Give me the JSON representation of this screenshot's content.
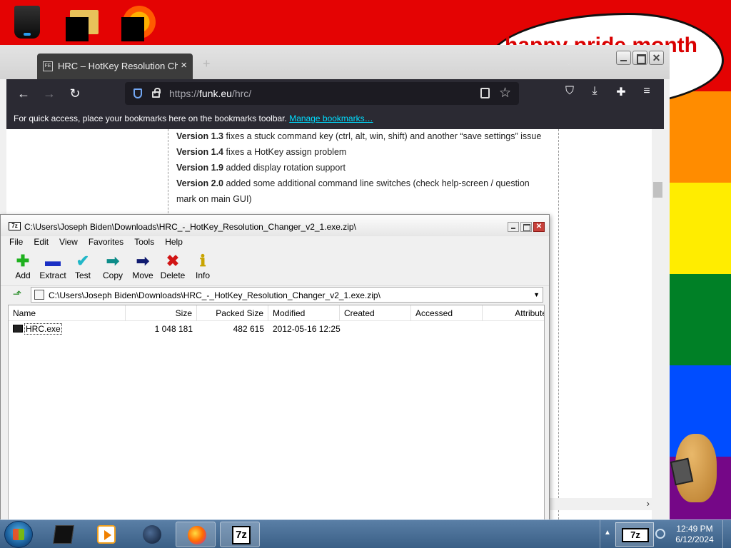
{
  "desktop": {
    "speech_text": "happy pride month",
    "icons": [
      "recycle-bin",
      "folder",
      "media-disc"
    ],
    "flag_colors": [
      "#e40303",
      "#ff8c00",
      "#ffed00",
      "#008026",
      "#004dff",
      "#750787"
    ]
  },
  "browser": {
    "tab_title": "HRC – HotKey Resolution Chan",
    "tab_favicon": "FE",
    "url_prefix": "https://",
    "url_host": "funk.eu",
    "url_path": "/hrc/",
    "bookmarks_text": "For quick access, place your bookmarks here on the bookmarks toolbar.",
    "bookmarks_link": "Manage bookmarks…",
    "content": [
      {
        "ver": "Version 1.3",
        "text": " fixes a stuck command key (ctrl, alt, win, shift) and another “save settings” issue"
      },
      {
        "ver": "Version 1.4",
        "text": " fixes a HotKey assign problem"
      },
      {
        "ver": "Version 1.9",
        "text": " added display rotation support"
      },
      {
        "ver": "Version 2.0",
        "text": " added some additional command line switches (check help-screen / question"
      },
      {
        "ver": "",
        "text": "mark on main GUI)"
      }
    ]
  },
  "zip": {
    "title": "C:\\Users\\Joseph Biden\\Downloads\\HRC_-_HotKey_Resolution_Changer_v2_1.exe.zip\\",
    "app_icon": "7z",
    "menu": [
      "File",
      "Edit",
      "View",
      "Favorites",
      "Tools",
      "Help"
    ],
    "toolbar": {
      "add": "Add",
      "extract": "Extract",
      "test": "Test",
      "copy": "Copy",
      "move": "Move",
      "delete": "Delete",
      "info": "Info"
    },
    "path": "C:\\Users\\Joseph Biden\\Downloads\\HRC_-_HotKey_Resolution_Changer_v2_1.exe.zip\\",
    "columns": {
      "name": "Name",
      "size": "Size",
      "packed": "Packed Size",
      "modified": "Modified",
      "created": "Created",
      "accessed": "Accessed",
      "attributes": "Attribute"
    },
    "files": [
      {
        "name": "HRC.exe",
        "size": "1 048 181",
        "packed": "482 615",
        "modified": "2012-05-16 12:25",
        "created": "",
        "accessed": "",
        "attributes": ""
      }
    ]
  },
  "taskbar": {
    "tray_7z": "7z",
    "apps": [
      "terminal",
      "media-player",
      "globe",
      "firefox",
      "7-zip"
    ],
    "time": "12:49 PM",
    "date": "6/12/2024"
  }
}
